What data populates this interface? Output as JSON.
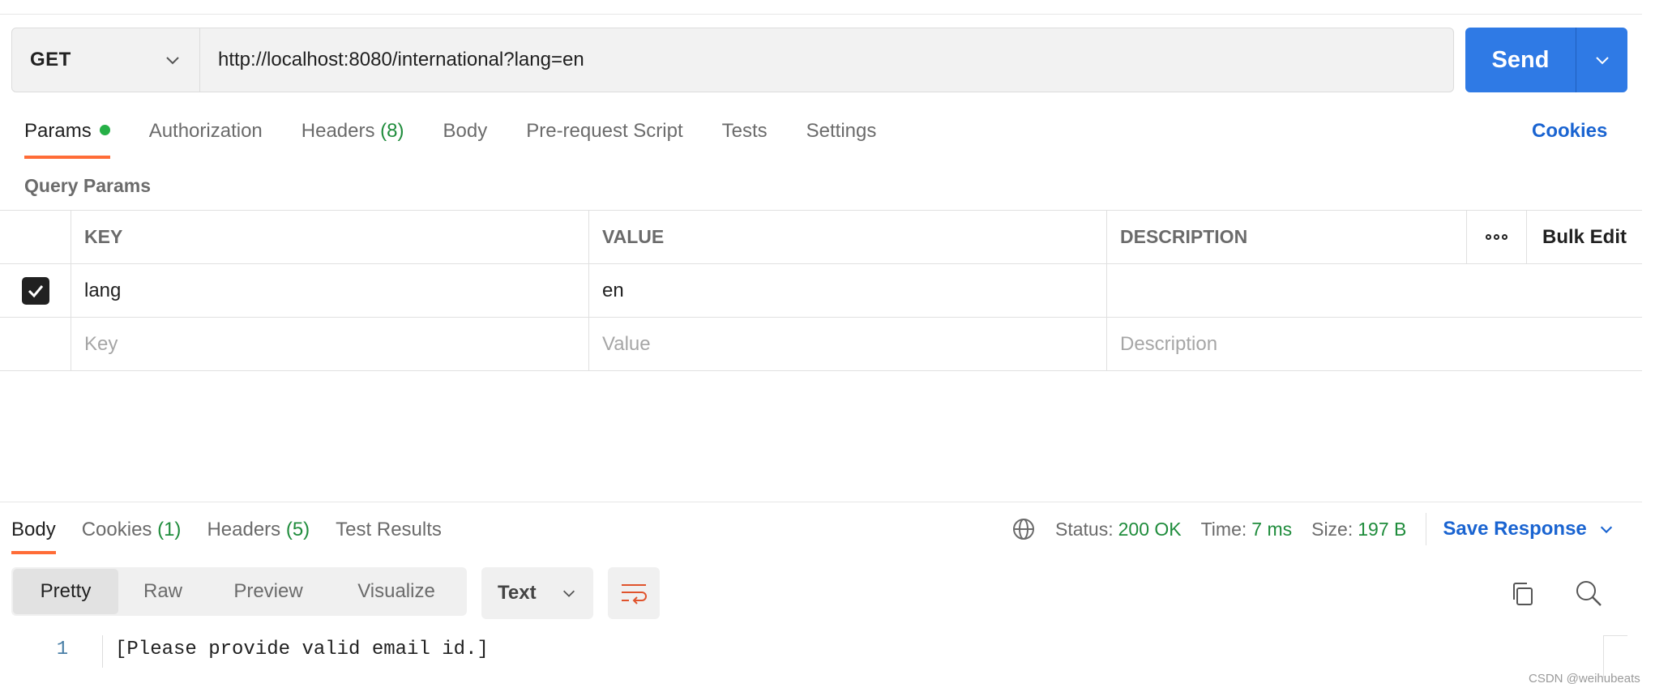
{
  "request": {
    "method": "GET",
    "url": "http://localhost:8080/international?lang=en",
    "send_label": "Send"
  },
  "request_tabs": [
    {
      "label": "Params",
      "count": "",
      "active": true
    },
    {
      "label": "Authorization",
      "count": ""
    },
    {
      "label": "Headers",
      "count": "(8)"
    },
    {
      "label": "Body",
      "count": ""
    },
    {
      "label": "Pre-request Script",
      "count": ""
    },
    {
      "label": "Tests",
      "count": ""
    },
    {
      "label": "Settings",
      "count": ""
    }
  ],
  "cookies_link": "Cookies",
  "query_params": {
    "title": "Query Params",
    "headers": {
      "key": "KEY",
      "value": "VALUE",
      "description": "DESCRIPTION",
      "bulk_edit": "Bulk Edit"
    },
    "rows": [
      {
        "checked": true,
        "key": "lang",
        "value": "en",
        "description": ""
      }
    ],
    "placeholders": {
      "key": "Key",
      "value": "Value",
      "description": "Description"
    }
  },
  "response": {
    "tabs": [
      {
        "label": "Body",
        "count": "",
        "active": true
      },
      {
        "label": "Cookies",
        "count": "(1)"
      },
      {
        "label": "Headers",
        "count": "(5)"
      },
      {
        "label": "Test Results",
        "count": ""
      }
    ],
    "status_label": "Status:",
    "status_value": "200 OK",
    "time_label": "Time:",
    "time_value": "7 ms",
    "size_label": "Size:",
    "size_value": "197 B",
    "save_label": "Save Response",
    "view_modes": [
      "Pretty",
      "Raw",
      "Preview",
      "Visualize"
    ],
    "format": "Text",
    "lines": [
      {
        "num": "1",
        "text": "[Please provide valid email id.]"
      }
    ]
  },
  "colors": {
    "accent_orange": "#ff6c37",
    "send_blue": "#2f7ae5",
    "link_blue": "#1a64d1",
    "status_green": "#1f8c3c"
  },
  "watermark": "CSDN @weihubeats"
}
